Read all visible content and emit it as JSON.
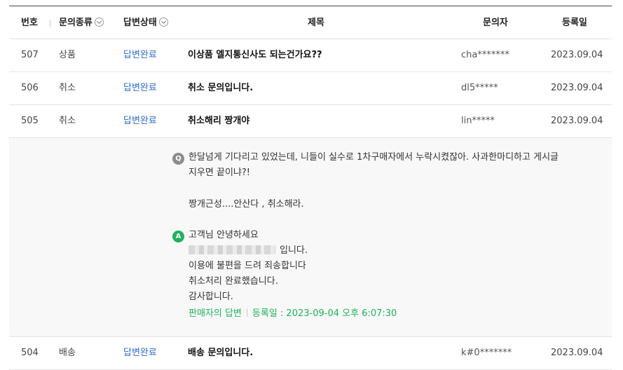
{
  "header": {
    "num": "번호",
    "category": "문의종류",
    "status": "답변상태",
    "title": "제목",
    "user": "문의자",
    "date": "등록일"
  },
  "rows": [
    {
      "num": "507",
      "category": "상품",
      "status": "답변완료",
      "title": "이상품 엘지통신사도 되는건가요??",
      "user": "cha*******",
      "date": "2023.09.04"
    },
    {
      "num": "506",
      "category": "취소",
      "status": "답변완료",
      "title": "취소 문의입니다.",
      "user": "dl5*****",
      "date": "2023.09.04"
    },
    {
      "num": "505",
      "category": "취소",
      "status": "답변완료",
      "title": "취소해리 짱개야",
      "user": "lin*****",
      "date": "2023.09.04"
    }
  ],
  "detail": {
    "q_badge": "Q",
    "question_line1": "한달넘게 기다리고 있었는데, 니들이 실수로 1차구매자에서 누락시켰잖아. 사과한마디하고 게시글",
    "question_line2": "지우면 끝이냐?!",
    "question_line3": "짱개근성....안산다 , 취소해라.",
    "a_badge": "A",
    "answer_line1": "고객님 안녕하세요",
    "answer_line2_suffix": "입니다.",
    "answer_line3": "이용에 불편을 드려 죄송합니다",
    "answer_line4": "취소처리 완료했습니다.",
    "answer_line5": "감사합니다.",
    "seller_label": "판매자의 답변",
    "answer_date": "등록일 : 2023-09-04 오후 6:07:30"
  },
  "last_row": {
    "num": "504",
    "category": "배송",
    "status": "답변완료",
    "title": "배송 문의입니다.",
    "user": "k#0*******",
    "date": "2023.09.04"
  }
}
